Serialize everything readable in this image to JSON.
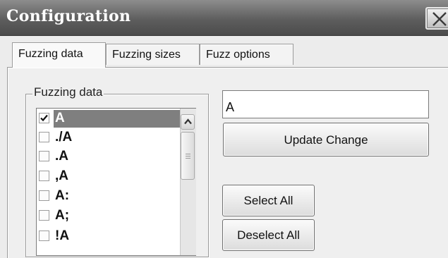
{
  "window": {
    "title": "Configuration",
    "close_icon": "close-icon"
  },
  "tabs": [
    {
      "label": "Fuzzing data",
      "active": true
    },
    {
      "label": "Fuzzing sizes",
      "active": false
    },
    {
      "label": "Fuzz options",
      "active": false
    }
  ],
  "fuzzing_data": {
    "group_label": "Fuzzing data",
    "items": [
      {
        "label": "A",
        "checked": true,
        "selected": true
      },
      {
        "label": "./A",
        "checked": false,
        "selected": false
      },
      {
        "label": ".A",
        "checked": false,
        "selected": false
      },
      {
        "label": ",A",
        "checked": false,
        "selected": false
      },
      {
        "label": "A:",
        "checked": false,
        "selected": false
      },
      {
        "label": "A;",
        "checked": false,
        "selected": false
      },
      {
        "label": "!A",
        "checked": false,
        "selected": false
      }
    ],
    "edit_value": "A",
    "update_button": "Update Change",
    "select_all_button": "Select All",
    "deselect_all_button": "Deselect All"
  }
}
